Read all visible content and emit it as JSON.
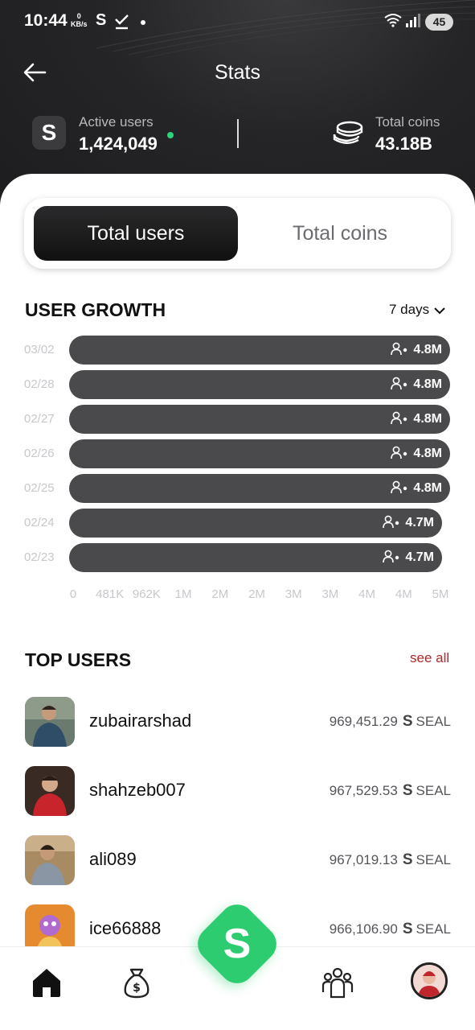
{
  "status_bar": {
    "time": "10:44",
    "net_speed_value": "0",
    "net_speed_unit": "KB/s",
    "app_letter": "S",
    "battery": "45"
  },
  "header": {
    "title": "Stats",
    "active_users_label": "Active users",
    "active_users_value": "1,424,049",
    "total_coins_label": "Total coins",
    "total_coins_value": "43.18B",
    "logo_letter": "S"
  },
  "tabs": [
    {
      "label": "Total users",
      "selected": true
    },
    {
      "label": "Total coins",
      "selected": false
    }
  ],
  "user_growth": {
    "title": "USER GROWTH",
    "range": "7 days"
  },
  "chart_data": {
    "type": "bar",
    "orientation": "horizontal",
    "categories": [
      "03/02",
      "02/28",
      "02/27",
      "02/26",
      "02/25",
      "02/24",
      "02/23"
    ],
    "values": [
      4.8,
      4.8,
      4.8,
      4.8,
      4.8,
      4.7,
      4.7
    ],
    "value_unit": "M",
    "data_labels": [
      "4.8M",
      "4.8M",
      "4.8M",
      "4.8M",
      "4.8M",
      "4.7M",
      "4.7M"
    ],
    "x_ticks": [
      "0",
      "481K",
      "962K",
      "1M",
      "2M",
      "2M",
      "3M",
      "3M",
      "4M",
      "4M",
      "5M"
    ],
    "xlim": [
      0,
      4.81
    ],
    "bar_color": "#4a4a4c"
  },
  "top_users": {
    "title": "TOP USERS",
    "see_all": "see all",
    "currency_symbol": "S",
    "currency": "SEAL",
    "users": [
      {
        "name": "zubairarshad",
        "amount": "969,451.29"
      },
      {
        "name": "shahzeb007",
        "amount": "967,529.53"
      },
      {
        "name": "ali089",
        "amount": "967,019.13"
      },
      {
        "name": "ice66888",
        "amount": "966,106.90"
      }
    ]
  },
  "bottom_nav": {
    "items": [
      "home-icon",
      "money-bag-icon",
      "fab-s",
      "team-icon",
      "profile-avatar"
    ],
    "fab_letter": "S",
    "fab_color": "#2ecc71",
    "accent_red": "#b3262a"
  }
}
